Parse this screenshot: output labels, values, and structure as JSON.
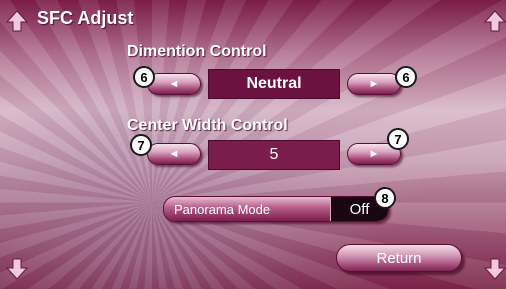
{
  "title": "SFC Adjust",
  "dimention": {
    "label": "Dimention Control",
    "value": "Neutral",
    "left_arrow": "◄",
    "right_arrow": "►",
    "badge_left": "6",
    "badge_right": "6"
  },
  "center_width": {
    "label": "Center Width Control",
    "value": "5",
    "left_arrow": "◄",
    "right_arrow": "►",
    "badge_left": "7",
    "badge_right": "7"
  },
  "panorama": {
    "label": "Panorama Mode",
    "value": "Off",
    "badge": "8"
  },
  "return_label": "Return",
  "icons": {
    "top_left": "up-arrow-icon",
    "top_right": "up-arrow-icon",
    "bottom_left": "down-arrow-icon",
    "bottom_right": "down-arrow-icon"
  },
  "colors": {
    "accent": "#7a1b45",
    "value_box": "#6b1240",
    "panorama_value": "#1a0610"
  }
}
